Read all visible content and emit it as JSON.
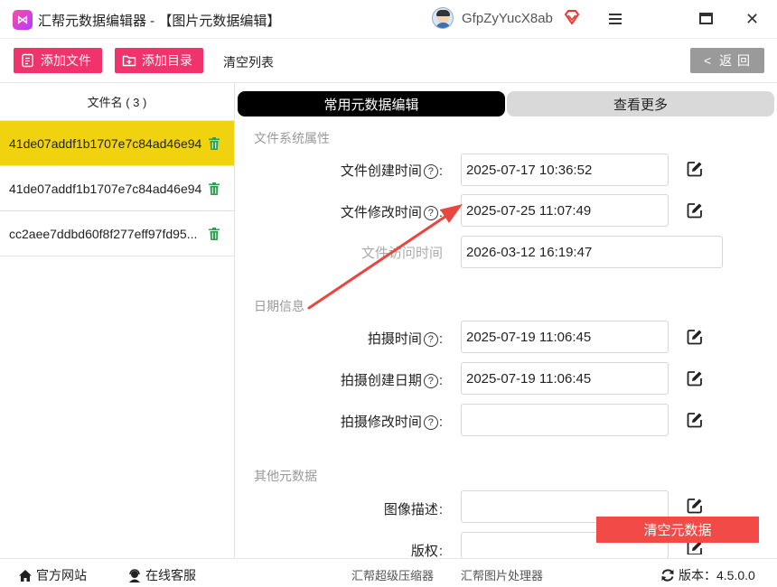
{
  "window": {
    "title": "汇帮元数据编辑器 - 【图片元数据编辑】",
    "username": "GfpZyYucX8ab"
  },
  "toolbar": {
    "add_file": "添加文件",
    "add_dir": "添加目录",
    "clear_list": "清空列表",
    "back": "返 回"
  },
  "files": {
    "header": "文件名 ( 3 )",
    "items": [
      {
        "name": "41de07addf1b1707e7c84ad46e94"
      },
      {
        "name": "41de07addf1b1707e7c84ad46e94"
      },
      {
        "name": "cc2aee7ddbd60f8f277eff97fd95..."
      }
    ]
  },
  "tabs": {
    "common": "常用元数据编辑",
    "more": "查看更多"
  },
  "sections": {
    "filesystem": "文件系统属性",
    "date": "日期信息",
    "other": "其他元数据"
  },
  "fields": {
    "created": {
      "label": "文件创建时间",
      "value": "2025-07-17 10:36:52"
    },
    "modified": {
      "label": "文件修改时间",
      "value": "2025-07-25 11:07:49"
    },
    "accessed": {
      "label": "文件访问时间",
      "value": "2026-03-12 16:19:47"
    },
    "shot_time": {
      "label": "拍摄时间",
      "value": "2025-07-19 11:06:45"
    },
    "shot_created": {
      "label": "拍摄创建日期",
      "value": "2025-07-19 11:06:45"
    },
    "shot_modified": {
      "label": "拍摄修改时间",
      "value": ""
    },
    "description": {
      "label": "图像描述",
      "value": ""
    },
    "copyright": {
      "label": "版权",
      "value": ""
    }
  },
  "actions": {
    "clear_metadata": "清空元数据"
  },
  "statusbar": {
    "website": "官方网站",
    "support": "在线客服",
    "link1": "汇帮超级压缩器",
    "link2": "汇帮图片处理器",
    "version": "版本：4.5.0.0"
  },
  "colors": {
    "accent": "#f0336a",
    "selected_row": "#f0d20f",
    "danger_button": "#f24a47",
    "annotation_arrow": "#e8463f"
  }
}
